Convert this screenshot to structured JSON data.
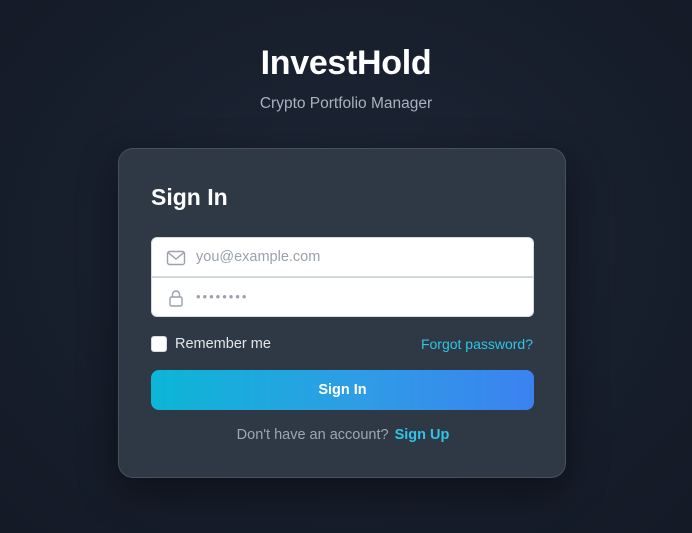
{
  "brand": {
    "name": "InvestHold",
    "tagline": "Crypto Portfolio Manager"
  },
  "form": {
    "title": "Sign In",
    "email": {
      "placeholder": "you@example.com",
      "value": "",
      "icon": "mail-icon"
    },
    "password": {
      "placeholder": "••••••••",
      "value": "",
      "icon": "lock-icon"
    },
    "remember": {
      "label": "Remember me",
      "checked": false
    },
    "forgot_label": "Forgot password?",
    "submit_label": "Sign In",
    "signup_prompt": "Don't have an account?",
    "signup_link": "Sign Up"
  },
  "colors": {
    "accent": "#2ec5e6",
    "button_gradient_start": "#0cb6d6",
    "button_gradient_end": "#3b82f0",
    "card_background": "#2f3845",
    "page_background": "#171e2c"
  }
}
